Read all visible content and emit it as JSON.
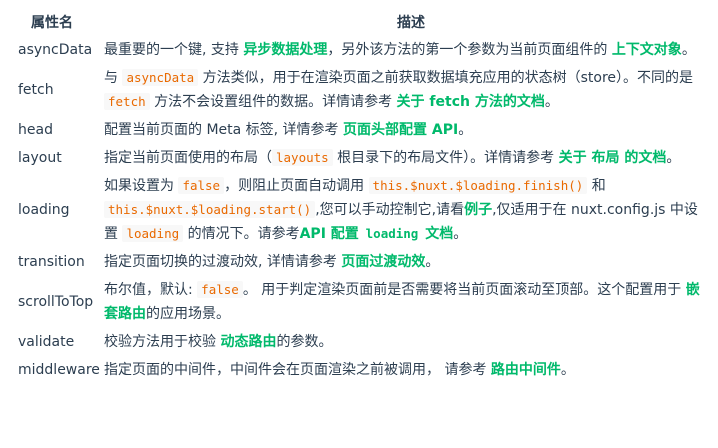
{
  "table": {
    "headers": {
      "name": "属性名",
      "desc": "描述"
    },
    "rows": [
      {
        "name": "asyncData",
        "segs": [
          {
            "t": "text",
            "v": "最重要的一个键, 支持 "
          },
          {
            "t": "link",
            "v": "异步数据处理"
          },
          {
            "t": "text",
            "v": "，另外该方法的第一个参数为当前页面组件的 "
          },
          {
            "t": "link",
            "v": "上下文对象"
          },
          {
            "t": "text",
            "v": "。"
          }
        ]
      },
      {
        "name": "fetch",
        "segs": [
          {
            "t": "text",
            "v": "与 "
          },
          {
            "t": "code",
            "v": "asyncData"
          },
          {
            "t": "text",
            "v": " 方法类似，用于在渲染页面之前获取数据填充应用的状态树（store）。不同的是 "
          },
          {
            "t": "code",
            "v": "fetch"
          },
          {
            "t": "text",
            "v": " 方法不会设置组件的数据。详情请参考 "
          },
          {
            "t": "link",
            "v": "关于 fetch 方法的文档"
          },
          {
            "t": "text",
            "v": "。"
          }
        ]
      },
      {
        "name": "head",
        "segs": [
          {
            "t": "text",
            "v": "配置当前页面的 Meta 标签, 详情参考 "
          },
          {
            "t": "link",
            "v": "页面头部配置 API"
          },
          {
            "t": "text",
            "v": "。"
          }
        ]
      },
      {
        "name": "layout",
        "segs": [
          {
            "t": "text",
            "v": "指定当前页面使用的布局（"
          },
          {
            "t": "code",
            "v": "layouts"
          },
          {
            "t": "text",
            "v": " 根目录下的布局文件）。详情请参考 "
          },
          {
            "t": "link",
            "v": "关于 布局 的文档"
          },
          {
            "t": "text",
            "v": "。"
          }
        ]
      },
      {
        "name": "loading",
        "segs": [
          {
            "t": "text",
            "v": "如果设置为 "
          },
          {
            "t": "code",
            "v": "false"
          },
          {
            "t": "text",
            "v": "，则阻止页面自动调用 "
          },
          {
            "t": "code",
            "v": "this.$nuxt.$loading.finish()"
          },
          {
            "t": "text",
            "v": " 和 "
          },
          {
            "t": "code",
            "v": "this.$nuxt.$loading.start()"
          },
          {
            "t": "text",
            "v": ",您可以手动控制它,请看"
          },
          {
            "t": "link",
            "v": "例子"
          },
          {
            "t": "text",
            "v": ",仅适用于在 nuxt.config.js 中设置 "
          },
          {
            "t": "code",
            "v": "loading"
          },
          {
            "t": "text",
            "v": " 的情况下。请参考"
          },
          {
            "t": "link",
            "v": "API 配置 "
          },
          {
            "t": "linkcode",
            "v": "loading"
          },
          {
            "t": "link",
            "v": " 文档"
          },
          {
            "t": "text",
            "v": "。"
          }
        ]
      },
      {
        "name": "transition",
        "segs": [
          {
            "t": "text",
            "v": "指定页面切换的过渡动效, 详情请参考 "
          },
          {
            "t": "link",
            "v": "页面过渡动效"
          },
          {
            "t": "text",
            "v": "。"
          }
        ]
      },
      {
        "name": "scrollToTop",
        "segs": [
          {
            "t": "text",
            "v": "布尔值，默认: "
          },
          {
            "t": "code",
            "v": "false"
          },
          {
            "t": "text",
            "v": "。 用于判定渲染页面前是否需要将当前页面滚动至顶部。这个配置用于 "
          },
          {
            "t": "link",
            "v": "嵌套路由"
          },
          {
            "t": "text",
            "v": "的应用场景。"
          }
        ]
      },
      {
        "name": "validate",
        "segs": [
          {
            "t": "text",
            "v": "校验方法用于校验 "
          },
          {
            "t": "link",
            "v": "动态路由"
          },
          {
            "t": "text",
            "v": "的参数。"
          }
        ]
      },
      {
        "name": "middleware",
        "segs": [
          {
            "t": "text",
            "v": "指定页面的中间件，中间件会在页面渲染之前被调用， 请参考 "
          },
          {
            "t": "link",
            "v": "路由中间件"
          },
          {
            "t": "text",
            "v": "。"
          }
        ]
      }
    ]
  }
}
